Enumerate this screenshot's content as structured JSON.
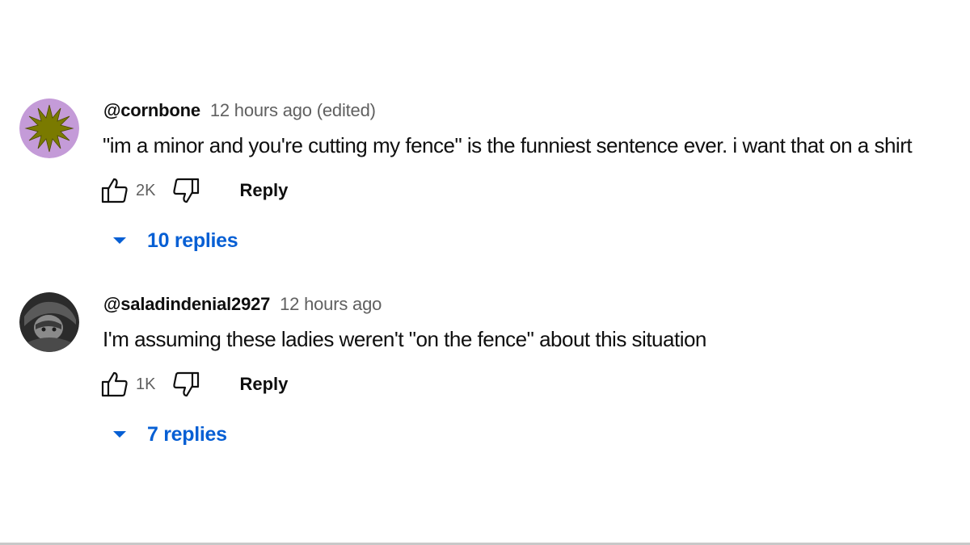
{
  "comments": [
    {
      "author": "@cornbone",
      "time": "12 hours ago (edited)",
      "text": "\"im a minor and you're cutting my fence\" is the funniest sentence ever. i want that on a shirt",
      "likes": "2K",
      "reply_label": "Reply",
      "replies_label": "10 replies",
      "avatar_icon": "sunburst-avatar-icon"
    },
    {
      "author": "@saladindenial2927",
      "time": "12 hours ago",
      "text": "I'm assuming these ladies weren't \"on the fence\" about this situation",
      "likes": "1K",
      "reply_label": "Reply",
      "replies_label": "7 replies",
      "avatar_icon": "dark-character-avatar-icon"
    }
  ],
  "colors": {
    "text_primary": "#0f0f0f",
    "text_secondary": "#606060",
    "link_blue": "#065fd4",
    "avatar1_bg": "#c49bd8",
    "avatar1_star": "#7a7a00"
  }
}
